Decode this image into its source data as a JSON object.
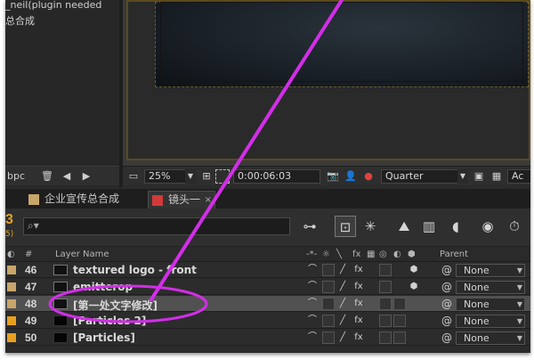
{
  "project": {
    "items": [
      {
        "label": "_neil(plugin needed"
      },
      {
        "label": "总合成"
      }
    ],
    "bottom_bar": {
      "bpc_label": "bpc"
    }
  },
  "viewer": {
    "zoom": "25%",
    "timecode": "0:00:06:03",
    "resolution": "Quarter",
    "view_label": "Ac"
  },
  "tabs": [
    {
      "label": "企业宣传总合成",
      "color": "#c8a66a"
    },
    {
      "label": "镜头一",
      "color": "#d23a3a"
    }
  ],
  "timeline": {
    "time_prefix": "3",
    "time_suffix": "5)",
    "search_icon": "magnifier-dropdown-icon"
  },
  "columns": {
    "number": "#",
    "layer_name": "Layer Name",
    "parent": "Parent"
  },
  "layers": [
    {
      "number": "46",
      "name": "textured logo - front",
      "label_color": "#c8a66a",
      "thumb": "comp",
      "parent": "None"
    },
    {
      "number": "47",
      "name": "emitterop",
      "label_color": "#c8a66a",
      "thumb": "comp",
      "parent": "None"
    },
    {
      "number": "48",
      "name": "[第一处文字修改]",
      "label_color": "#c8a66a",
      "thumb": "comp",
      "parent": "None",
      "selected": true
    },
    {
      "number": "49",
      "name": "[Particles 2]",
      "label_color": "#e8a020",
      "thumb": "solid",
      "parent": "None"
    },
    {
      "number": "50",
      "name": "[Particles]",
      "label_color": "#e8a020",
      "thumb": "solid",
      "parent": "None"
    }
  ],
  "annotation": {
    "color": "#d22ee8"
  }
}
